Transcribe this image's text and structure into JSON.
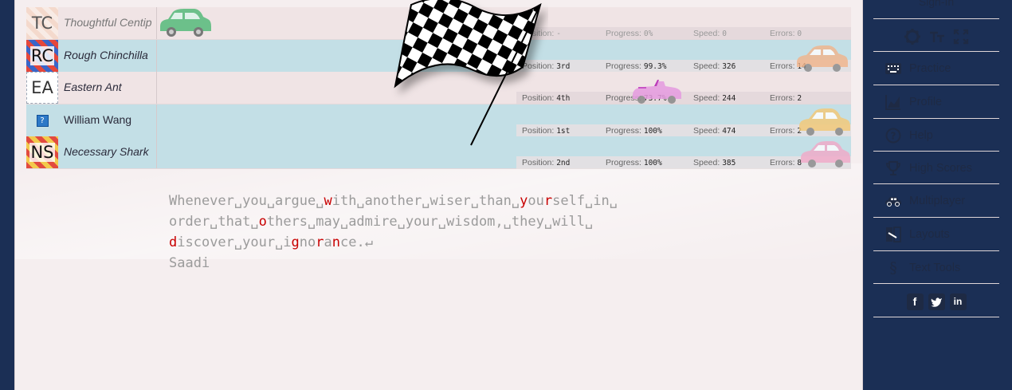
{
  "race": {
    "rows": [
      {
        "initials": "TC",
        "name": "Thoughtful Centip",
        "position": "-",
        "progress": "0%",
        "speed": "0",
        "errors": "0"
      },
      {
        "initials": "RC",
        "name": "Rough Chinchilla",
        "position": "3rd",
        "progress": "99.3%",
        "speed": "326",
        "errors": "14"
      },
      {
        "initials": "EA",
        "name": "Eastern Ant",
        "position": "4th",
        "progress": "73.7%",
        "speed": "244",
        "errors": "2"
      },
      {
        "initials": "?",
        "name": "William Wang",
        "position": "1st",
        "progress": "100%",
        "speed": "474",
        "errors": "2"
      },
      {
        "initials": "NS",
        "name": "Necessary Shark",
        "position": "2nd",
        "progress": "100%",
        "speed": "385",
        "errors": "8"
      }
    ],
    "labels": {
      "position": "Position:",
      "progress": "Progress:",
      "speed": "Speed:",
      "errors": "Errors:"
    }
  },
  "text": {
    "lines": [
      [
        {
          "t": "Whenever␣you␣argue␣"
        },
        {
          "t": "w",
          "e": true
        },
        {
          "t": "ith␣another␣wiser␣than␣"
        },
        {
          "t": "y",
          "e": true
        },
        {
          "t": "ou"
        },
        {
          "t": "r",
          "e": true
        },
        {
          "t": "self␣in␣"
        }
      ],
      [
        {
          "t": "order␣that␣"
        },
        {
          "t": "o",
          "e": true
        },
        {
          "t": "thers␣may␣admire␣your␣wisdom,␣they␣will␣"
        }
      ],
      [
        {
          "t": "d",
          "e": true
        },
        {
          "t": "iscover␣your␣i"
        },
        {
          "t": "g",
          "e": true
        },
        {
          "t": "no"
        },
        {
          "t": "r",
          "e": true
        },
        {
          "t": "a"
        },
        {
          "t": "n",
          "e": true
        },
        {
          "t": "ce.↵"
        }
      ],
      [
        {
          "t": "Saadi"
        }
      ]
    ]
  },
  "sidebar": {
    "sign_in": "Sign-In",
    "items": [
      {
        "label": "Practice",
        "icon": "keyboard-icon"
      },
      {
        "label": "Profile",
        "icon": "chart-icon"
      },
      {
        "label": "Help",
        "icon": "help-icon"
      },
      {
        "label": "High Scores",
        "icon": "trophy-icon"
      },
      {
        "label": "Multiplayer",
        "icon": "car-icon"
      },
      {
        "label": "Layouts",
        "icon": "layouts-icon"
      },
      {
        "label": "Text Tools",
        "icon": "section-icon"
      }
    ],
    "social": [
      "facebook-icon",
      "twitter-icon",
      "linkedin-icon"
    ]
  },
  "colors": {
    "accent": "#1e2a44",
    "error": "#c80000",
    "row_blue": "#c3dfe6",
    "row_pink": "#f0e4e5"
  }
}
